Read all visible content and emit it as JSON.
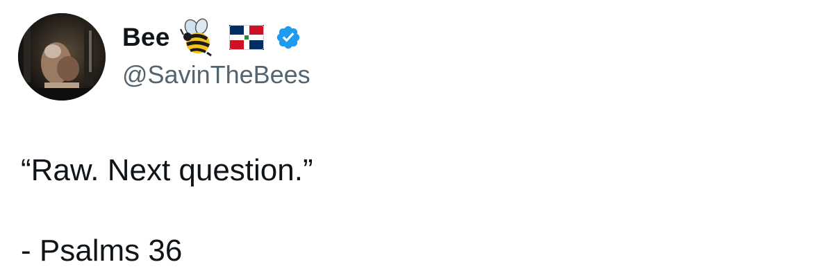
{
  "author": {
    "display_name": "Bee",
    "handle": "@SavinTheBees",
    "icons": [
      "bee-emoji-icon",
      "dominican-republic-flag-icon",
      "verified-badge-icon"
    ],
    "verified_color": "#1d9bf0"
  },
  "tweet": {
    "lines": [
      "“Raw. Next question.”",
      "- Psalms 36"
    ]
  },
  "colors": {
    "text": "#0f1419",
    "secondary_text": "#536471",
    "background": "#ffffff"
  }
}
